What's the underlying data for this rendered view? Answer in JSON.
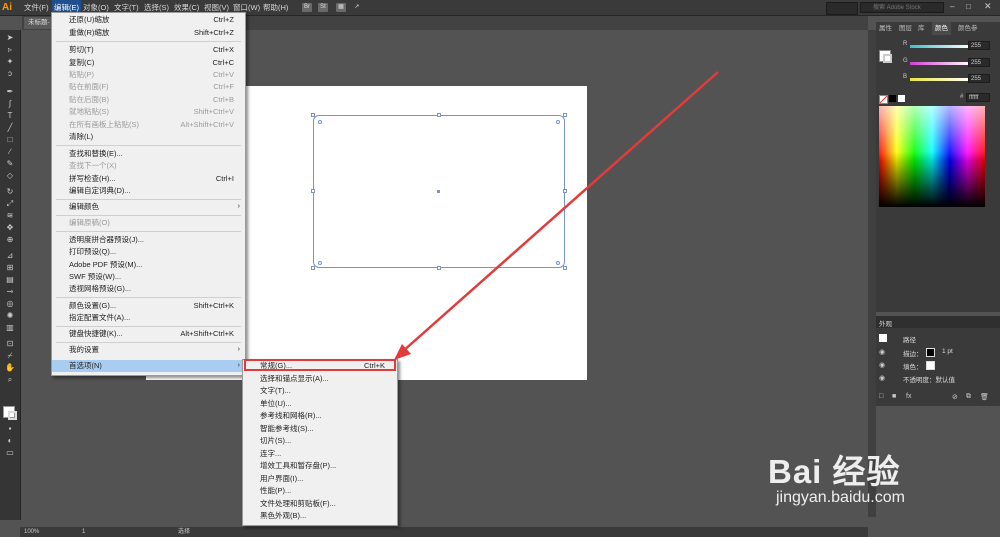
{
  "colors": {
    "accent": "#1f4f8f",
    "highlight_red": "#e23b3b",
    "selection": "#a9cdf0",
    "object_stroke": "#7896c8"
  },
  "menubar": {
    "logo": "Ai",
    "items": [
      "文件(F)",
      "编辑(E)",
      "对象(O)",
      "文字(T)",
      "选择(S)",
      "效果(C)",
      "视图(V)",
      "窗口(W)",
      "帮助(H)"
    ],
    "icons": [
      "Br",
      "St"
    ],
    "search_placeholder": "搜索 Adobe Stock"
  },
  "doc_tab": {
    "label": "未标题-"
  },
  "edit_menu": {
    "items": [
      {
        "label": "还原(U)缩放",
        "shortcut": "Ctrl+Z",
        "disabled": false
      },
      {
        "label": "重做(R)缩放",
        "shortcut": "Shift+Ctrl+Z",
        "disabled": false
      },
      {
        "label": "剪切(T)",
        "shortcut": "Ctrl+X",
        "disabled": false
      },
      {
        "label": "复制(C)",
        "shortcut": "Ctrl+C",
        "disabled": false
      },
      {
        "label": "粘贴(P)",
        "shortcut": "Ctrl+V",
        "disabled": true
      },
      {
        "label": "贴在前面(F)",
        "shortcut": "Ctrl+F",
        "disabled": true
      },
      {
        "label": "贴在后面(B)",
        "shortcut": "Ctrl+B",
        "disabled": true
      },
      {
        "label": "就地粘贴(S)",
        "shortcut": "Shift+Ctrl+V",
        "disabled": true
      },
      {
        "label": "在所有画板上粘贴(S)",
        "shortcut": "Alt+Shift+Ctrl+V",
        "disabled": true
      },
      {
        "label": "清除(L)",
        "shortcut": "",
        "disabled": false
      },
      {
        "label": "查找和替换(E)...",
        "shortcut": "",
        "disabled": false
      },
      {
        "label": "查找下一个(X)",
        "shortcut": "",
        "disabled": true
      },
      {
        "label": "拼写检查(H)...",
        "shortcut": "Ctrl+I",
        "disabled": false
      },
      {
        "label": "编辑自定词典(D)...",
        "shortcut": "",
        "disabled": false
      },
      {
        "label": "编辑颜色",
        "shortcut": "",
        "disabled": false,
        "submenu": true
      },
      {
        "label": "编辑原稿(O)",
        "shortcut": "",
        "disabled": true
      },
      {
        "label": "透明度拼合器预设(J)...",
        "shortcut": "",
        "disabled": false
      },
      {
        "label": "打印预设(Q)...",
        "shortcut": "",
        "disabled": false
      },
      {
        "label": "Adobe PDF 预设(M)...",
        "shortcut": "",
        "disabled": false
      },
      {
        "label": "SWF 预设(W)...",
        "shortcut": "",
        "disabled": false
      },
      {
        "label": "透视网格预设(G)...",
        "shortcut": "",
        "disabled": false
      },
      {
        "label": "颜色设置(G)...",
        "shortcut": "Shift+Ctrl+K",
        "disabled": false
      },
      {
        "label": "指定配置文件(A)...",
        "shortcut": "",
        "disabled": false
      },
      {
        "label": "键盘快捷键(K)...",
        "shortcut": "Alt+Shift+Ctrl+K",
        "disabled": false
      },
      {
        "label": "我的设置",
        "shortcut": "",
        "disabled": false,
        "submenu": true
      },
      {
        "label": "首选项(N)",
        "shortcut": "",
        "disabled": false,
        "submenu": true,
        "selected": true
      }
    ]
  },
  "pref_menu": {
    "items": [
      {
        "label": "常规(G)...",
        "shortcut": "Ctrl+K"
      },
      {
        "label": "选择和锚点显示(A)...",
        "shortcut": ""
      },
      {
        "label": "文字(T)...",
        "shortcut": ""
      },
      {
        "label": "单位(U)...",
        "shortcut": ""
      },
      {
        "label": "参考线和网格(R)...",
        "shortcut": ""
      },
      {
        "label": "智能参考线(S)...",
        "shortcut": ""
      },
      {
        "label": "切片(S)...",
        "shortcut": ""
      },
      {
        "label": "连字...",
        "shortcut": ""
      },
      {
        "label": "增效工具和暂存盘(P)...",
        "shortcut": ""
      },
      {
        "label": "用户界面(I)...",
        "shortcut": ""
      },
      {
        "label": "性能(P)...",
        "shortcut": ""
      },
      {
        "label": "文件处理和剪贴板(F)...",
        "shortcut": ""
      },
      {
        "label": "黑色外观(B)...",
        "shortcut": ""
      }
    ]
  },
  "color_panel": {
    "tabs": [
      "属性",
      "图层",
      "库",
      "颜色",
      "颜色参"
    ],
    "channels": [
      {
        "name": "R",
        "value": "255",
        "color": "#38c0c8"
      },
      {
        "name": "G",
        "value": "255",
        "color": "#d040d0"
      },
      {
        "name": "B",
        "value": "255",
        "color": "#e8e840"
      }
    ],
    "hex": "ffffff"
  },
  "appearance_panel": {
    "title": "外观",
    "path_label": "路径",
    "stroke_label": "描边：",
    "stroke_value": "1 pt",
    "fill_label": "填色：",
    "opacity_label": "不透明度：默认值"
  },
  "status": {
    "zoom": "100%",
    "page": "1",
    "tool": "选择"
  },
  "watermark": {
    "brand": "Bai 经验",
    "url": "jingyan.baidu.com"
  }
}
